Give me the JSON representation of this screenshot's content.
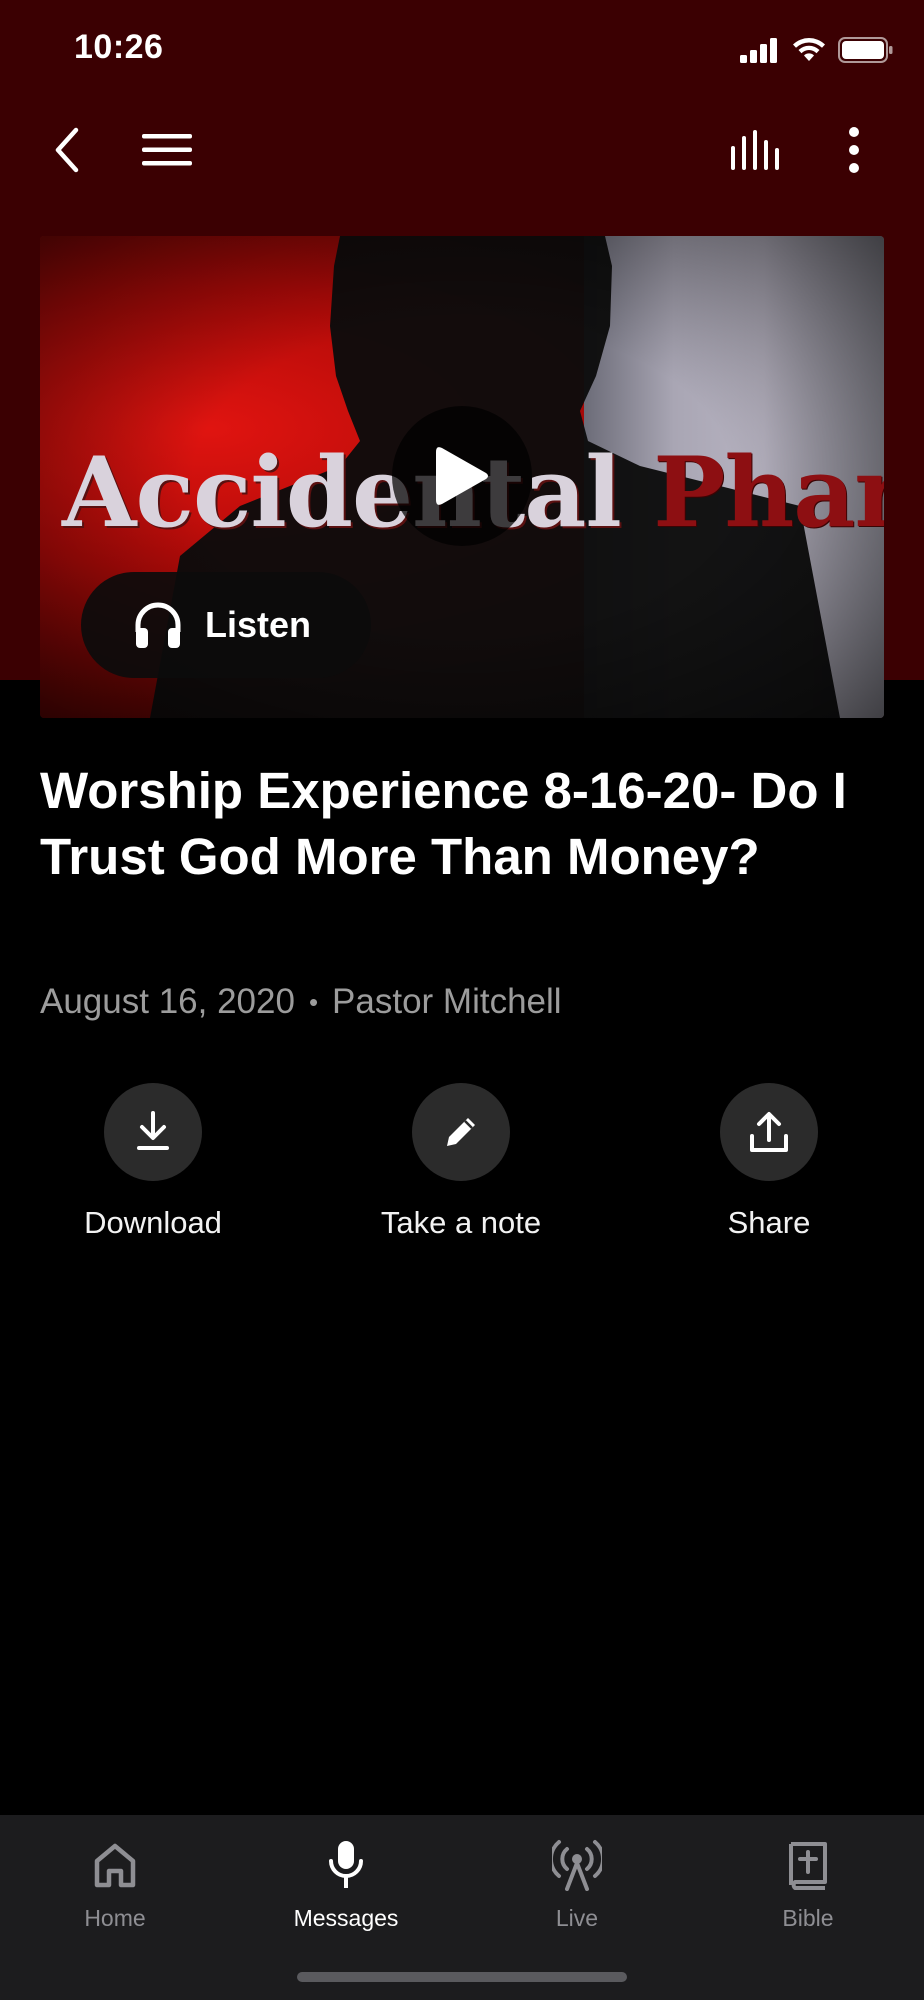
{
  "status_bar": {
    "time": "10:26"
  },
  "nav": {
    "back_icon": "chevron-left-icon",
    "menu_icon": "hamburger-menu-icon",
    "audio_icon": "equalizer-icon",
    "more_icon": "more-vertical-icon"
  },
  "artwork": {
    "title_word1": "Accidental",
    "title_word2": "Pharisees",
    "play_icon": "play-icon",
    "listen_label": "Listen"
  },
  "message": {
    "title": "Worship Experience 8-16-20- Do I Trust God More Than Money?",
    "date": "August 16, 2020",
    "separator": "•",
    "speaker": "Pastor Mitchell"
  },
  "actions": [
    {
      "label": "Download",
      "icon": "download-icon"
    },
    {
      "label": "Take a note",
      "icon": "pencil-icon"
    },
    {
      "label": "Share",
      "icon": "share-icon"
    }
  ],
  "tabs": [
    {
      "label": "Home",
      "icon": "home-icon",
      "active": false
    },
    {
      "label": "Messages",
      "icon": "microphone-icon",
      "active": true
    },
    {
      "label": "Live",
      "icon": "broadcast-icon",
      "active": false
    },
    {
      "label": "Bible",
      "icon": "bible-icon",
      "active": false
    }
  ],
  "colors": {
    "header_bg": "#3b0002",
    "background": "#000000",
    "tabbar_bg": "#1c1c1e",
    "action_circle": "#2b2b2b",
    "meta_text": "#9c9c9c"
  }
}
